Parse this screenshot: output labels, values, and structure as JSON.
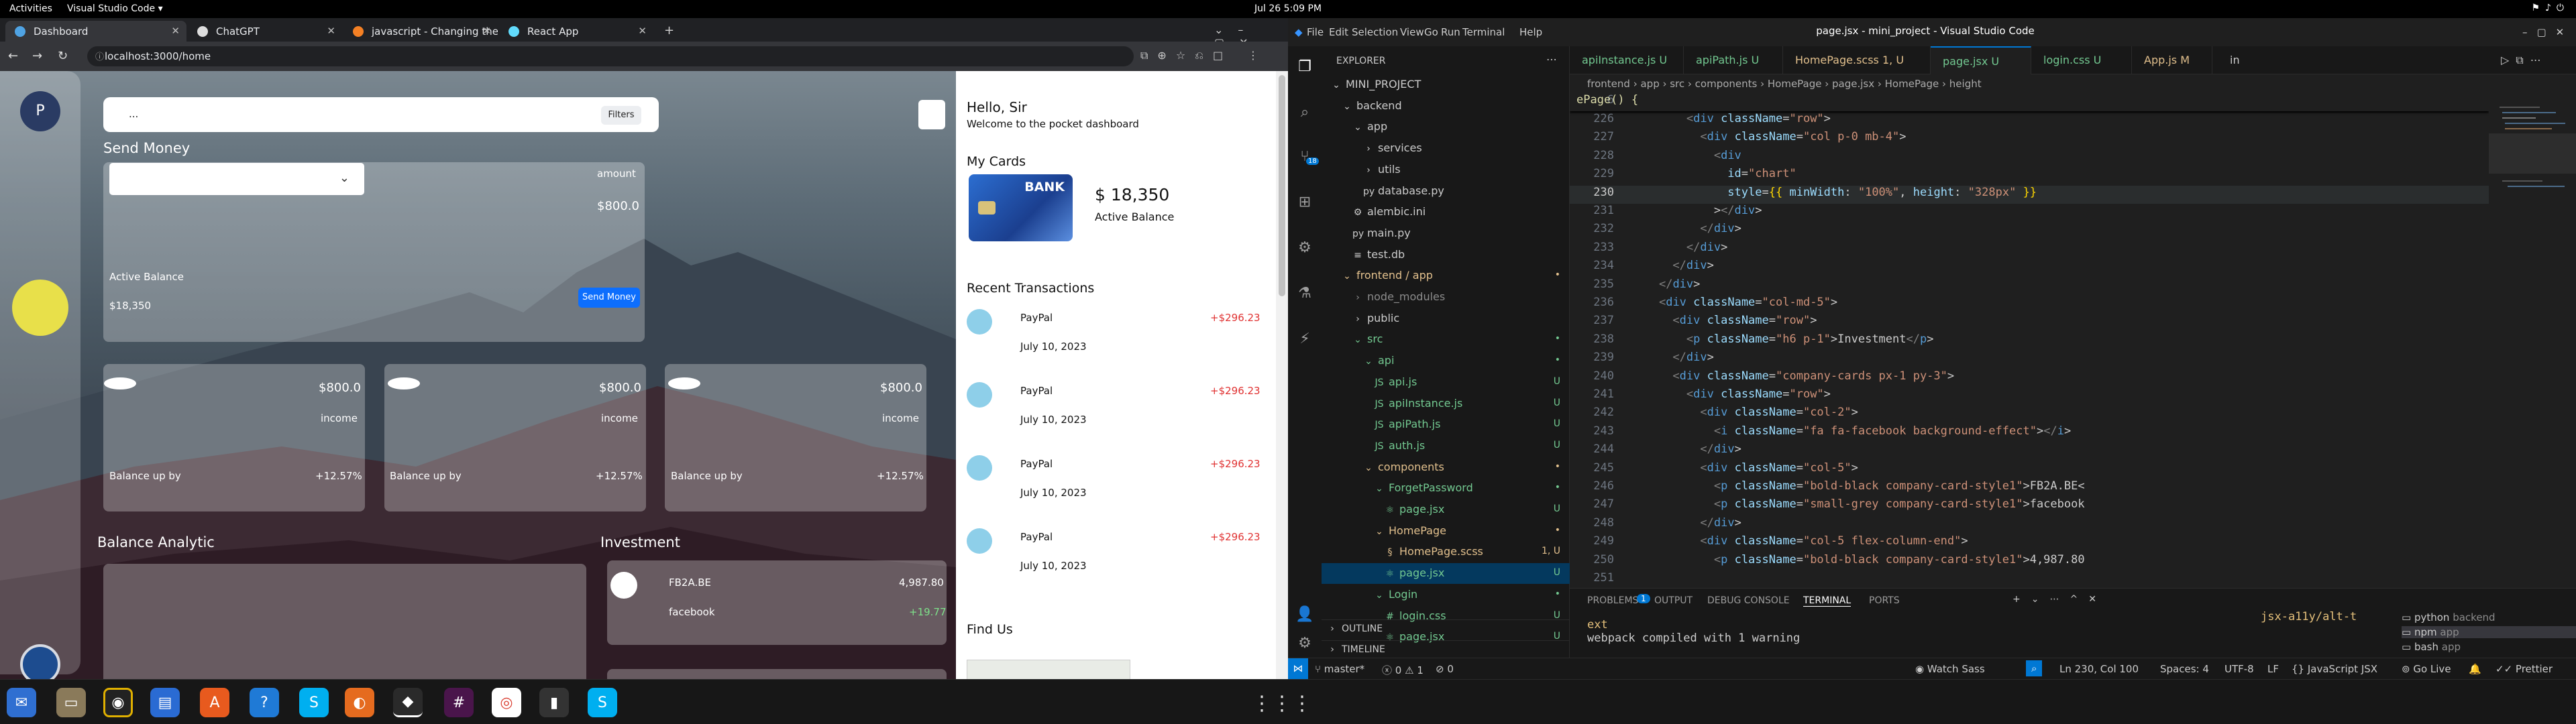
{
  "os": {
    "activities": "Activities",
    "app": "Visual Studio Code ▾",
    "clock": "Jul 26  5:09 PM"
  },
  "chrome": {
    "tabs": [
      {
        "label": "Dashboard"
      },
      {
        "label": "ChatGPT"
      },
      {
        "label": "javascript - Changing the"
      },
      {
        "label": "React App"
      }
    ],
    "url": "localhost:3000/home"
  },
  "app": {
    "avatar_letter": "P",
    "search_value": "...",
    "filter_label": "Filters",
    "send_money_title": "Send Money",
    "amount_label": "amount",
    "amount_value": "$800.0",
    "active_balance_label": "Active Balance",
    "active_balance_value": "$18,350",
    "send_button": "Send Money",
    "income_cards": [
      {
        "value": "$800.0",
        "label": "income",
        "footer": "Balance up by",
        "pct": "+12.57%"
      },
      {
        "value": "$800.0",
        "label": "income",
        "footer": "Balance up by",
        "pct": "+12.57%"
      },
      {
        "value": "$800.0",
        "label": "income",
        "footer": "Balance up by",
        "pct": "+12.57%"
      }
    ],
    "balance_analytic_title": "Balance Analytic",
    "investment_title": "Investment",
    "investment": {
      "name": "FB2A.BE",
      "value": "4,987.80",
      "sub": "facebook",
      "change": "+19.77"
    },
    "greeting": "Hello, Sir",
    "welcome": "Welcome to the pocket dashboard",
    "my_cards_title": "My Cards",
    "card_bank": "BANK",
    "card_balance": "$ 18,350",
    "card_label": "Active Balance",
    "recent_title": "Recent Transactions",
    "transactions": [
      {
        "name": "PayPal",
        "date": "July 10, 2023",
        "amount": "+$296.23"
      },
      {
        "name": "PayPal",
        "date": "July 10, 2023",
        "amount": "+$296.23"
      },
      {
        "name": "PayPal",
        "date": "July 10, 2023",
        "amount": "+$296.23"
      },
      {
        "name": "PayPal",
        "date": "July 10, 2023",
        "amount": "+$296.23"
      }
    ],
    "find_us_title": "Find Us"
  },
  "vscode": {
    "title": "page.jsx - mini_project - Visual Studio Code",
    "menu": [
      "File",
      "Edit",
      "Selection",
      "View",
      "Go",
      "Run",
      "Terminal",
      "Help"
    ],
    "explorer_title": "EXPLORER",
    "activity_badge": "18",
    "tree": [
      {
        "label": "MINI_PROJECT",
        "depth": 0,
        "icon": "⌄",
        "color": "#ccc",
        "status": ""
      },
      {
        "label": "backend",
        "depth": 1,
        "icon": "⌄",
        "color": "#ccc",
        "status": ""
      },
      {
        "label": "app",
        "depth": 2,
        "icon": "⌄",
        "color": "#ccc",
        "status": ""
      },
      {
        "label": "services",
        "depth": 3,
        "icon": "›",
        "color": "#ccc",
        "status": ""
      },
      {
        "label": "utils",
        "depth": 3,
        "icon": "›",
        "color": "#ccc",
        "status": ""
      },
      {
        "label": "database.py",
        "depth": 3,
        "icon": "py",
        "color": "#ccc",
        "status": ""
      },
      {
        "label": "alembic.ini",
        "depth": 2,
        "icon": "⚙",
        "color": "#ccc",
        "status": ""
      },
      {
        "label": "main.py",
        "depth": 2,
        "icon": "py",
        "color": "#ccc",
        "status": ""
      },
      {
        "label": "test.db",
        "depth": 2,
        "icon": "≡",
        "color": "#ccc",
        "status": ""
      },
      {
        "label": "frontend / app",
        "depth": 1,
        "icon": "⌄",
        "color": "#e2c08d",
        "status": "•"
      },
      {
        "label": "node_modules",
        "depth": 2,
        "icon": "›",
        "color": "#8c8c8c",
        "status": ""
      },
      {
        "label": "public",
        "depth": 2,
        "icon": "›",
        "color": "#ccc",
        "status": ""
      },
      {
        "label": "src",
        "depth": 2,
        "icon": "⌄",
        "color": "#73c991",
        "status": "•"
      },
      {
        "label": "api",
        "depth": 3,
        "icon": "⌄",
        "color": "#73c991",
        "status": "•"
      },
      {
        "label": "api.js",
        "depth": 4,
        "icon": "JS",
        "color": "#73c991",
        "status": "U"
      },
      {
        "label": "apiInstance.js",
        "depth": 4,
        "icon": "JS",
        "color": "#73c991",
        "status": "U"
      },
      {
        "label": "apiPath.js",
        "depth": 4,
        "icon": "JS",
        "color": "#73c991",
        "status": "U"
      },
      {
        "label": "auth.js",
        "depth": 4,
        "icon": "JS",
        "color": "#73c991",
        "status": "U"
      },
      {
        "label": "components",
        "depth": 3,
        "icon": "⌄",
        "color": "#e2c08d",
        "status": "•"
      },
      {
        "label": "ForgetPassword",
        "depth": 4,
        "icon": "⌄",
        "color": "#73c991",
        "status": "•"
      },
      {
        "label": "page.jsx",
        "depth": 5,
        "icon": "⚛",
        "color": "#73c991",
        "status": "U"
      },
      {
        "label": "HomePage",
        "depth": 4,
        "icon": "⌄",
        "color": "#e2c08d",
        "status": "•"
      },
      {
        "label": "HomePage.scss",
        "depth": 5,
        "icon": "§",
        "color": "#e2c08d",
        "status": "1, U"
      },
      {
        "label": "page.jsx",
        "depth": 5,
        "icon": "⚛",
        "color": "#73c991",
        "status": "U"
      },
      {
        "label": "Login",
        "depth": 4,
        "icon": "⌄",
        "color": "#73c991",
        "status": "•"
      },
      {
        "label": "login.css",
        "depth": 5,
        "icon": "#",
        "color": "#73c991",
        "status": "U"
      },
      {
        "label": "page.jsx",
        "depth": 5,
        "icon": "⚛",
        "color": "#73c991",
        "status": "U"
      }
    ],
    "outline": "OUTLINE",
    "timeline": "TIMELINE",
    "editor_tabs": [
      {
        "label": "apiInstance.js  U",
        "color": "#73c991"
      },
      {
        "label": "apiPath.js  U",
        "color": "#73c991"
      },
      {
        "label": "HomePage.scss  1, U",
        "color": "#e2c08d"
      },
      {
        "label": "page.jsx  U",
        "color": "#73c991"
      },
      {
        "label": "login.css  U",
        "color": "#73c991"
      },
      {
        "label": "App.js  M",
        "color": "#e2c08d"
      }
    ],
    "tabs_overflow": "in",
    "breadcrumb": "frontend › app › src › components › HomePage › page.jsx › HomePage › height",
    "sticky_line": "6",
    "sticky_text": "ePage() {",
    "code": [
      {
        "n": "226",
        "t": "        <div className=\"row\">"
      },
      {
        "n": "227",
        "t": "          <div className=\"col p-0 mb-4\">"
      },
      {
        "n": "228",
        "t": "            <div"
      },
      {
        "n": "229",
        "t": "              id=\"chart\""
      },
      {
        "n": "230",
        "t": "              style={{ minWidth: \"100%\", height: \"328px\" }}"
      },
      {
        "n": "231",
        "t": "            ></div>"
      },
      {
        "n": "232",
        "t": "          </div>"
      },
      {
        "n": "233",
        "t": "        </div>"
      },
      {
        "n": "234",
        "t": "      </div>"
      },
      {
        "n": "235",
        "t": "    </div>"
      },
      {
        "n": "236",
        "t": "    <div className=\"col-md-5\">"
      },
      {
        "n": "237",
        "t": "      <div className=\"row\">"
      },
      {
        "n": "238",
        "t": "        <p className=\"h6 p-1\">Investment</p>"
      },
      {
        "n": "239",
        "t": "      </div>"
      },
      {
        "n": "240",
        "t": "      <div className=\"company-cards px-1 py-3\">"
      },
      {
        "n": "241",
        "t": "        <div className=\"row\">"
      },
      {
        "n": "242",
        "t": "          <div className=\"col-2\">"
      },
      {
        "n": "243",
        "t": "            <i className=\"fa fa-facebook background-effect\"></i>"
      },
      {
        "n": "244",
        "t": "          </div>"
      },
      {
        "n": "245",
        "t": "          <div className=\"col-5\">"
      },
      {
        "n": "246",
        "t": "            <p className=\"bold-black company-card-style1\">FB2A.BE<"
      },
      {
        "n": "247",
        "t": "            <p className=\"small-grey company-card-style1\">facebook"
      },
      {
        "n": "248",
        "t": "          </div>"
      },
      {
        "n": "249",
        "t": "          <div className=\"col-5 flex-column-end\">"
      },
      {
        "n": "250",
        "t": "            <p className=\"bold-black company-card-style1\">4,987.80"
      },
      {
        "n": "251",
        "t": ""
      }
    ],
    "panel_tabs": [
      "PROBLEMS",
      "OUTPUT",
      "DEBUG CONSOLE",
      "TERMINAL",
      "PORTS"
    ],
    "problems_count": "1",
    "terminal_lines": [
      "ext",
      "webpack compiled with 1 warning"
    ],
    "terminal_hint": "jsx-a11y/alt-t",
    "terminals": [
      {
        "name": "python",
        "tag": "backend"
      },
      {
        "name": "npm",
        "tag": "app"
      },
      {
        "name": "bash",
        "tag": "app"
      }
    ],
    "status": {
      "branch": "master*",
      "errors": "0",
      "warnings": "1",
      "ports": "0",
      "watch": "Watch Sass",
      "pos": "Ln 230, Col 100",
      "spaces": "Spaces: 4",
      "enc": "UTF-8",
      "eol": "LF",
      "lang": "JavaScript JSX",
      "golive": "Go Live",
      "prettier": "Prettier"
    }
  }
}
